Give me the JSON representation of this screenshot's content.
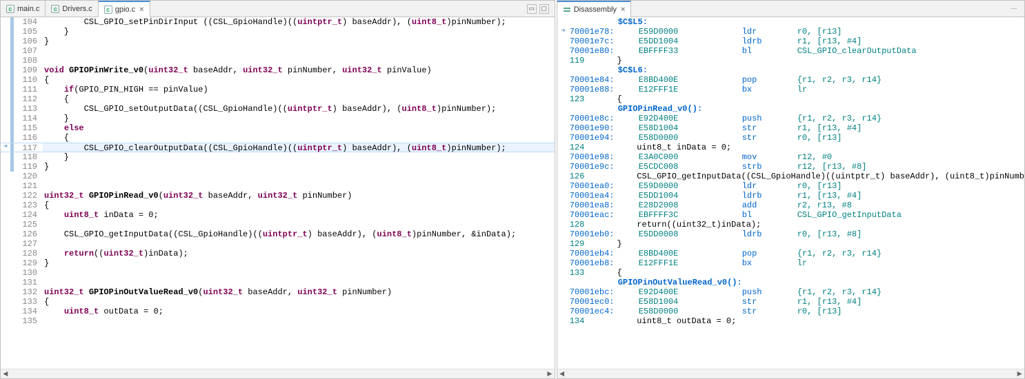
{
  "left": {
    "tabs": [
      {
        "label": "main.c",
        "active": false,
        "icon": "c"
      },
      {
        "label": "Drivers.c",
        "active": false,
        "icon": "c"
      },
      {
        "label": "gpio.c",
        "active": true,
        "icon": "c"
      }
    ],
    "lines": [
      {
        "n": 104,
        "blue": true,
        "tokens": [
          {
            "t": "        CSL_GPIO_setPinDirInput ((CSL_GpioHandle)(("
          },
          {
            "t": "uintptr_t",
            "c": "typ"
          },
          {
            "t": ") baseAddr), ("
          },
          {
            "t": "uint8_t",
            "c": "typ"
          },
          {
            "t": ")pinNumber);"
          }
        ]
      },
      {
        "n": 105,
        "blue": true,
        "tokens": [
          {
            "t": "    }"
          }
        ]
      },
      {
        "n": 106,
        "blue": true,
        "tokens": [
          {
            "t": "}"
          }
        ]
      },
      {
        "n": 107,
        "blue": true,
        "tokens": [
          {
            "t": ""
          }
        ]
      },
      {
        "n": 108,
        "blue": true,
        "tokens": [
          {
            "t": ""
          }
        ]
      },
      {
        "n": 109,
        "blue": true,
        "tokens": [
          {
            "t": "void ",
            "c": "kw"
          },
          {
            "t": "GPIOPinWrite_v0",
            "c": "fn"
          },
          {
            "t": "("
          },
          {
            "t": "uint32_t",
            "c": "typ"
          },
          {
            "t": " baseAddr, "
          },
          {
            "t": "uint32_t",
            "c": "typ"
          },
          {
            "t": " pinNumber, "
          },
          {
            "t": "uint32_t",
            "c": "typ"
          },
          {
            "t": " pinValue)"
          }
        ]
      },
      {
        "n": 110,
        "blue": true,
        "tokens": [
          {
            "t": "{"
          }
        ]
      },
      {
        "n": 111,
        "blue": true,
        "tokens": [
          {
            "t": "    "
          },
          {
            "t": "if",
            "c": "kw"
          },
          {
            "t": "(GPIO_PIN_HIGH == pinValue)"
          }
        ]
      },
      {
        "n": 112,
        "blue": true,
        "tokens": [
          {
            "t": "    {"
          }
        ]
      },
      {
        "n": 113,
        "blue": true,
        "tokens": [
          {
            "t": "        CSL_GPIO_setOutputData((CSL_GpioHandle)(("
          },
          {
            "t": "uintptr_t",
            "c": "typ"
          },
          {
            "t": ") baseAddr), ("
          },
          {
            "t": "uint8_t",
            "c": "typ"
          },
          {
            "t": ")pinNumber);"
          }
        ]
      },
      {
        "n": 114,
        "blue": true,
        "tokens": [
          {
            "t": "    }"
          }
        ]
      },
      {
        "n": 115,
        "blue": true,
        "tokens": [
          {
            "t": "    "
          },
          {
            "t": "else",
            "c": "kw"
          }
        ]
      },
      {
        "n": 116,
        "blue": true,
        "tokens": [
          {
            "t": "    {"
          }
        ]
      },
      {
        "n": 117,
        "blue": true,
        "current": true,
        "arrow": true,
        "tokens": [
          {
            "t": "        CSL_GPIO_clearOutputData((CSL_GpioHandle)(("
          },
          {
            "t": "uintptr_t",
            "c": "typ"
          },
          {
            "t": ") baseAddr), ("
          },
          {
            "t": "uint8_t",
            "c": "typ"
          },
          {
            "t": ")pinNumber);"
          }
        ]
      },
      {
        "n": 118,
        "blue": true,
        "tokens": [
          {
            "t": "    }"
          }
        ]
      },
      {
        "n": 119,
        "blue": true,
        "tokens": [
          {
            "t": "}"
          }
        ]
      },
      {
        "n": 120,
        "tokens": [
          {
            "t": ""
          }
        ]
      },
      {
        "n": 121,
        "tokens": [
          {
            "t": ""
          }
        ]
      },
      {
        "n": 122,
        "tokens": [
          {
            "t": "uint32_t ",
            "c": "typ"
          },
          {
            "t": "GPIOPinRead_v0",
            "c": "fn"
          },
          {
            "t": "("
          },
          {
            "t": "uint32_t",
            "c": "typ"
          },
          {
            "t": " baseAddr, "
          },
          {
            "t": "uint32_t",
            "c": "typ"
          },
          {
            "t": " pinNumber)"
          }
        ]
      },
      {
        "n": 123,
        "tokens": [
          {
            "t": "{"
          }
        ]
      },
      {
        "n": 124,
        "tokens": [
          {
            "t": "    "
          },
          {
            "t": "uint8_t",
            "c": "typ"
          },
          {
            "t": " inData = 0;"
          }
        ]
      },
      {
        "n": 125,
        "tokens": [
          {
            "t": ""
          }
        ]
      },
      {
        "n": 126,
        "tokens": [
          {
            "t": "    CSL_GPIO_getInputData((CSL_GpioHandle)(("
          },
          {
            "t": "uintptr_t",
            "c": "typ"
          },
          {
            "t": ") baseAddr), ("
          },
          {
            "t": "uint8_t",
            "c": "typ"
          },
          {
            "t": ")pinNumber, &inData);"
          }
        ]
      },
      {
        "n": 127,
        "tokens": [
          {
            "t": ""
          }
        ]
      },
      {
        "n": 128,
        "tokens": [
          {
            "t": "    "
          },
          {
            "t": "return",
            "c": "kw"
          },
          {
            "t": "(("
          },
          {
            "t": "uint32_t",
            "c": "typ"
          },
          {
            "t": ")inData);"
          }
        ]
      },
      {
        "n": 129,
        "tokens": [
          {
            "t": "}"
          }
        ]
      },
      {
        "n": 130,
        "tokens": [
          {
            "t": ""
          }
        ]
      },
      {
        "n": 131,
        "tokens": [
          {
            "t": ""
          }
        ]
      },
      {
        "n": 132,
        "tokens": [
          {
            "t": "uint32_t ",
            "c": "typ"
          },
          {
            "t": "GPIOPinOutValueRead_v0",
            "c": "fn"
          },
          {
            "t": "("
          },
          {
            "t": "uint32_t",
            "c": "typ"
          },
          {
            "t": " baseAddr, "
          },
          {
            "t": "uint32_t",
            "c": "typ"
          },
          {
            "t": " pinNumber)"
          }
        ]
      },
      {
        "n": 133,
        "tokens": [
          {
            "t": "{"
          }
        ]
      },
      {
        "n": 134,
        "tokens": [
          {
            "t": "    "
          },
          {
            "t": "uint8_t",
            "c": "typ"
          },
          {
            "t": " outData = 0;"
          }
        ]
      },
      {
        "n": 135,
        "tokens": [
          {
            "t": ""
          }
        ]
      }
    ]
  },
  "right": {
    "tab_label": "Disassembly",
    "lines": [
      {
        "type": "label",
        "text": "$C$L5:"
      },
      {
        "type": "asm",
        "arrow": true,
        "exec": true,
        "addr": "70001e78:",
        "hex": "E59D0000",
        "mn": "ldr",
        "args": "r0, [r13]"
      },
      {
        "type": "asm",
        "addr": "70001e7c:",
        "hex": "E5DD1004",
        "mn": "ldrb",
        "args": "r1, [r13, #4]"
      },
      {
        "type": "asm",
        "addr": "70001e80:",
        "hex": "EBFFFF33",
        "mn": "bl",
        "args": "CSL_GPIO_clearOutputData"
      },
      {
        "type": "c",
        "ln": "119",
        "text": "    }"
      },
      {
        "type": "label",
        "text": "$C$L6:"
      },
      {
        "type": "asm",
        "addr": "70001e84:",
        "hex": "E8BD400E",
        "mn": "pop",
        "args": "{r1, r2, r3, r14}"
      },
      {
        "type": "asm",
        "addr": "70001e88:",
        "hex": "E12FFF1E",
        "mn": "bx",
        "args": "lr"
      },
      {
        "type": "c",
        "ln": "123",
        "text": "    {"
      },
      {
        "type": "label",
        "text": "GPIOPinRead_v0():"
      },
      {
        "type": "asm",
        "addr": "70001e8c:",
        "hex": "E92D400E",
        "mn": "push",
        "args": "{r1, r2, r3, r14}"
      },
      {
        "type": "asm",
        "addr": "70001e90:",
        "hex": "E58D1004",
        "mn": "str",
        "args": "r1, [r13, #4]"
      },
      {
        "type": "asm",
        "addr": "70001e94:",
        "hex": "E58D0000",
        "mn": "str",
        "args": "r0, [r13]"
      },
      {
        "type": "c",
        "ln": "124",
        "text": "        uint8_t inData = 0;"
      },
      {
        "type": "asm",
        "addr": "70001e98:",
        "hex": "E3A0C000",
        "mn": "mov",
        "args": "r12, #0"
      },
      {
        "type": "asm",
        "addr": "70001e9c:",
        "hex": "E5CDC008",
        "mn": "strb",
        "args": "r12, [r13, #8]"
      },
      {
        "type": "c",
        "ln": "126",
        "text": "        CSL_GPIO_getInputData((CSL_GpioHandle)((uintptr_t) baseAddr), (uint8_t)pinNumb"
      },
      {
        "type": "asm",
        "addr": "70001ea0:",
        "hex": "E59D0000",
        "mn": "ldr",
        "args": "r0, [r13]"
      },
      {
        "type": "asm",
        "addr": "70001ea4:",
        "hex": "E5DD1004",
        "mn": "ldrb",
        "args": "r1, [r13, #4]"
      },
      {
        "type": "asm",
        "addr": "70001ea8:",
        "hex": "E28D2008",
        "mn": "add",
        "args": "r2, r13, #8"
      },
      {
        "type": "asm",
        "addr": "70001eac:",
        "hex": "EBFFFF3C",
        "mn": "bl",
        "args": "CSL_GPIO_getInputData"
      },
      {
        "type": "c",
        "ln": "128",
        "text": "        return((uint32_t)inData);"
      },
      {
        "type": "asm",
        "addr": "70001eb0:",
        "hex": "E5DD0008",
        "mn": "ldrb",
        "args": "r0, [r13, #8]"
      },
      {
        "type": "c",
        "ln": "129",
        "text": "    }"
      },
      {
        "type": "asm",
        "addr": "70001eb4:",
        "hex": "E8BD400E",
        "mn": "pop",
        "args": "{r1, r2, r3, r14}"
      },
      {
        "type": "asm",
        "addr": "70001eb8:",
        "hex": "E12FFF1E",
        "mn": "bx",
        "args": "lr"
      },
      {
        "type": "c",
        "ln": "133",
        "text": "    {"
      },
      {
        "type": "label",
        "text": "GPIOPinOutValueRead_v0():"
      },
      {
        "type": "asm",
        "addr": "70001ebc:",
        "hex": "E92D400E",
        "mn": "push",
        "args": "{r1, r2, r3, r14}"
      },
      {
        "type": "asm",
        "addr": "70001ec0:",
        "hex": "E58D1004",
        "mn": "str",
        "args": "r1, [r13, #4]"
      },
      {
        "type": "asm",
        "addr": "70001ec4:",
        "hex": "E58D0000",
        "mn": "str",
        "args": "r0, [r13]"
      },
      {
        "type": "c",
        "ln": "134",
        "text": "        uint8_t outData = 0;"
      }
    ]
  }
}
